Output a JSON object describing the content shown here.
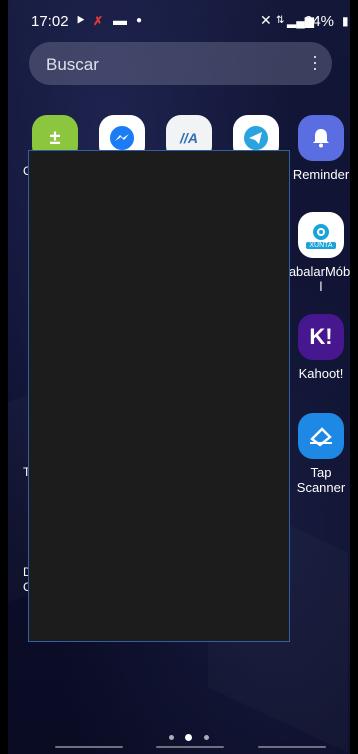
{
  "status_bar": {
    "time": "17:02",
    "battery": "64%"
  },
  "search": {
    "placeholder": "Buscar"
  },
  "apps": {
    "reminder": "Reminder",
    "xunta_badge": "XUNTA",
    "abalar": "abalarMóbil",
    "kahoot": "Kahoot!",
    "tap_scanner": "Tap Scanner"
  },
  "colors": {
    "calculator": "#8cc63f",
    "messenger": "#ffffff",
    "telegram": "#ffffff",
    "reminder": "#5b6ee1",
    "kahoot": "#46178f",
    "tap_scanner": "#1e88e5",
    "overlay": "#1c1c1c",
    "overlay_border": "#2f5fa8"
  },
  "pager": {
    "pages": 3,
    "active": 1
  }
}
